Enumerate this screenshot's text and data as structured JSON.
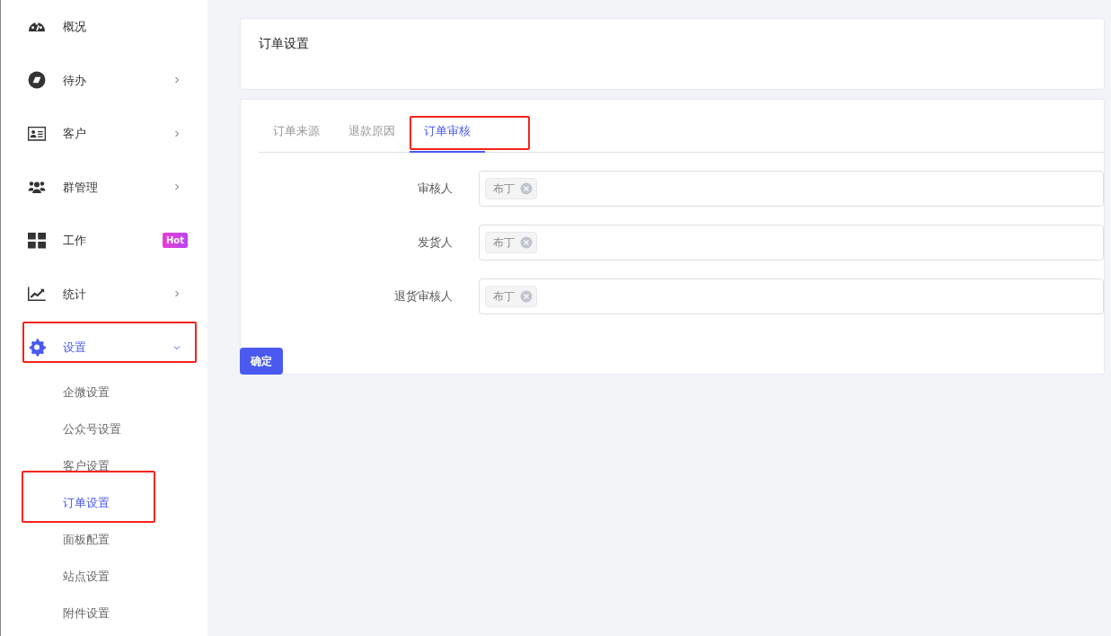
{
  "menu": [
    {
      "label": "概况",
      "selected": false,
      "highlighted": false
    },
    {
      "label": "待办",
      "selected": false,
      "highlighted": false,
      "expanded": false
    },
    {
      "label": "客户",
      "selected": false,
      "highlighted": false,
      "expanded": false
    },
    {
      "label": "群管理",
      "selected": false,
      "highlighted": false,
      "expanded": false
    },
    {
      "label": "工作",
      "selected": false,
      "highlighted": false,
      "badge": "Hot"
    },
    {
      "label": "统计",
      "selected": false,
      "highlighted": false,
      "expanded": false
    },
    {
      "label": "设置",
      "selected": true,
      "highlighted": true,
      "expanded": true,
      "children": [
        {
          "label": "企微设置",
          "selected": false,
          "highlighted": false
        },
        {
          "label": "公众号设置",
          "selected": false,
          "highlighted": false
        },
        {
          "label": "客户设置",
          "selected": false,
          "highlighted": false
        },
        {
          "label": "订单设置",
          "selected": true,
          "highlighted": true
        },
        {
          "label": "面板配置",
          "selected": false,
          "highlighted": false
        },
        {
          "label": "站点设置",
          "selected": false,
          "highlighted": false
        },
        {
          "label": "附件设置",
          "selected": false,
          "highlighted": false
        }
      ]
    }
  ],
  "page_title": "订单设置",
  "tabs": [
    {
      "label": "订单来源",
      "selected": false,
      "highlighted": false
    },
    {
      "label": "退款原因",
      "selected": false,
      "highlighted": false
    },
    {
      "label": "订单审核",
      "selected": true,
      "highlighted": true
    }
  ],
  "fields": [
    {
      "label": "审核人",
      "tags": [
        "布丁"
      ]
    },
    {
      "label": "发货人",
      "tags": [
        "布丁"
      ]
    },
    {
      "label": "退货审核人",
      "tags": [
        "布丁"
      ]
    }
  ],
  "submit_button": "确定"
}
